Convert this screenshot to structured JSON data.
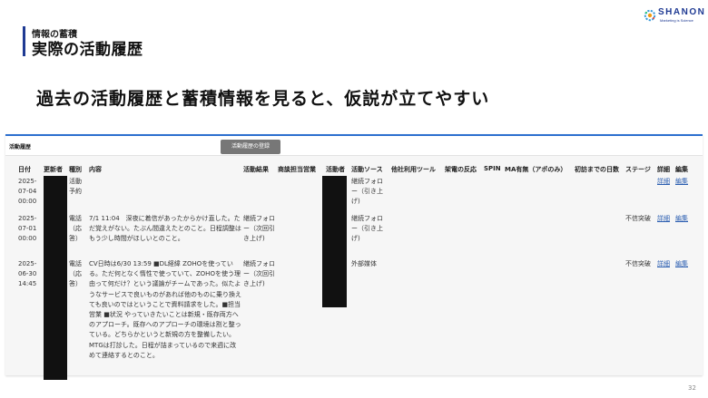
{
  "slide": {
    "section_label": "情報の蓄積",
    "title": "実際の活動履歴",
    "headline": "過去の活動履歴と蓄積情報を見ると、仮説が立てやすい",
    "page_number": "32"
  },
  "logo": {
    "name": "SHANON",
    "tagline": "Marketing is Science"
  },
  "panel": {
    "title": "活動履歴",
    "register_button": "活動履歴の登録",
    "columns": [
      "日付",
      "更新者",
      "種別",
      "内容",
      "活動結果",
      "商談担当営業",
      "活動者",
      "活動ソース",
      "他社利用ツール",
      "架電の反応",
      "SPIN",
      "MA有無（アポのみ）",
      "初訪までの日数",
      "ステージ",
      "詳細",
      "編集"
    ],
    "rows": [
      {
        "date": "2025-07-04 00:00",
        "type": "活動予約",
        "content": "",
        "result": "",
        "source": "継続フォロー（引き上げ)",
        "stage": "",
        "detail": "詳細",
        "edit": "編集"
      },
      {
        "date": "2025-07-01 00:00",
        "type": "電話（応答）",
        "content": "7/1 11:04　深夜に着信があったからかけ直した。ただ覚えがない。たぶん間違えたとのこと。日程調整はもう少し時間がほしいとのこと。",
        "result": "継続フォロー（次回引き上げ)",
        "source": "継続フォロー（引き上げ)",
        "stage": "不信突破",
        "detail": "詳細",
        "edit": "編集"
      },
      {
        "date": "2025-06-30 14:45",
        "type": "電話（応答）",
        "content": "CV日時は6/30 13:59 ■DL経緯 ZOHOを使っている。ただ何となく惰性で使っていて、ZOHOを使う理由って何だけ？という議論がチームであった。似たようなサービスで良いものがあれば他のものに乗り換えても良いのではということで資料請求をした。■担当 営業 ■状況 やっていきたいことは新規・既存両方へのアプローチ。既存へのアプローチの環境は割と整っている。どちらかというと新規の方を整備したい。MTGは打診した。日程が詰まっているので来週に改めて連絡するとのこと。",
        "result": "継続フォロー（次回引き上げ)",
        "source": "外部媒体",
        "stage": "不信突破",
        "detail": "詳細",
        "edit": "編集"
      }
    ]
  }
}
